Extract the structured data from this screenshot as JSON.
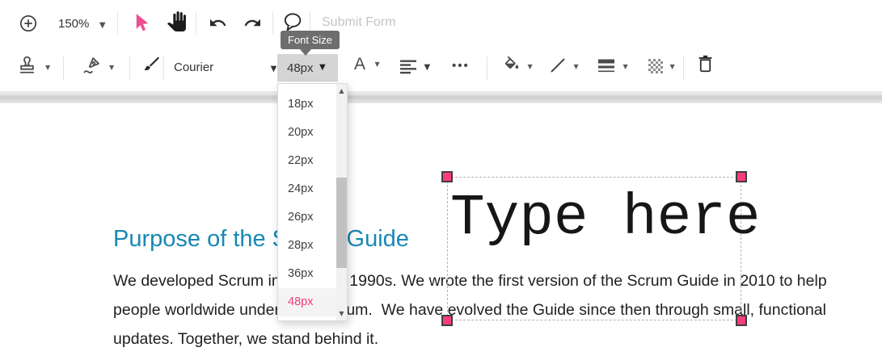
{
  "colors": {
    "accent_pink": "#f23d77",
    "handle_pink": "#fb3e78",
    "heading_blue": "#1788b5",
    "tooltip_gray": "#6e6e6e"
  },
  "glyphs": {
    "caret_down": "▼",
    "scroll_up": "▲",
    "scroll_down": "▼",
    "more_dots": "•••"
  },
  "toolbar_primary": {
    "zoom_level": "150%",
    "submit_form_label": "Submit Form"
  },
  "tooltip": {
    "label": "Font Size"
  },
  "toolbar_secondary": {
    "font_family_value": "Courier",
    "font_size_value": "48px",
    "font_color_label": "A"
  },
  "font_size_menu": {
    "options": [
      "18px",
      "20px",
      "22px",
      "24px",
      "26px",
      "28px",
      "36px",
      "48px"
    ],
    "selected": "48px"
  },
  "document": {
    "heading": "Purpose of the Scrum Guide",
    "body_lines": [
      "We developed Scrum in the early 1990s. We wrote the first version of the Scrum Guide in 2010 to help",
      "people worldwide understand Scrum.  We have evolved the Guide since then through small, functional",
      "updates. Together, we stand behind it."
    ]
  },
  "text_field": {
    "value": "Type here"
  }
}
